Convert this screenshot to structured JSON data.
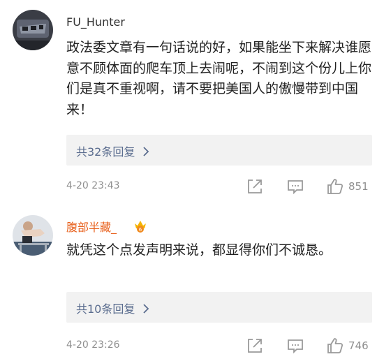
{
  "comments": [
    {
      "username": "FU_Hunter",
      "text": "政法委文章有一句话说的好，如果能坐下来解决谁愿意不顾体面的爬车顶上去闹呢，不闹到这个份儿上你们是真不重视啊，请不要把美国人的傲慢带到中国来！",
      "replies_label": "共32条回复",
      "timestamp": "4-20 23:43",
      "likes": "851",
      "username_color": "#333333"
    },
    {
      "username": "腹部半藏_",
      "text": "就凭这个点发声明来说，都显得你们不诚恳。",
      "replies_label": "共10条回复",
      "timestamp": "4-20 23:26",
      "likes": "746",
      "username_color": "#e8601c"
    }
  ],
  "icons": {
    "chevron": "chevron-right-icon",
    "share": "share-icon",
    "reply": "comment-icon",
    "like": "thumbs-up-icon",
    "badge": "vip-crown-badge-icon"
  },
  "colors": {
    "link": "#5b6d8f",
    "meta": "#8f8f8f",
    "vip_name": "#e8601c"
  }
}
